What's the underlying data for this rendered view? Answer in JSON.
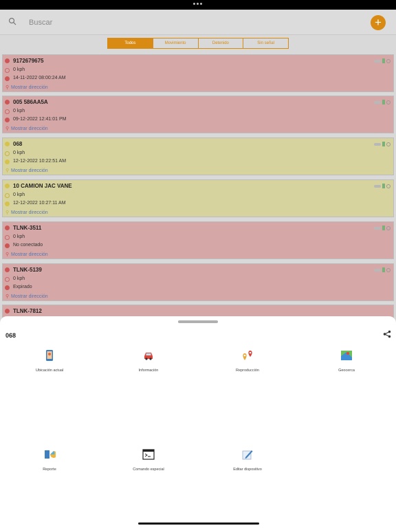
{
  "search": {
    "placeholder": "Buscar"
  },
  "add_label": "+",
  "tabs": [
    "Todos",
    "Movimiento",
    "Detenido",
    "Sin señal"
  ],
  "devices": [
    {
      "name": "9172679675",
      "speed": "0 kph",
      "time": "14-11-2022 08:00:24 AM",
      "address": "Mostrar dirección",
      "color": "red"
    },
    {
      "name": "005 586AA5A",
      "speed": "0 kph",
      "time": "09-12-2022 12:41:01 PM",
      "address": "Mostrar dirección",
      "color": "red"
    },
    {
      "name": "068",
      "speed": "0 kph",
      "time": "12-12-2022 10:22:51 AM",
      "address": "Mostrar dirección",
      "color": "yellow"
    },
    {
      "name": "10 CAMION JAC VANE",
      "speed": "0 kph",
      "time": "12-12-2022 10:27:11 AM",
      "address": "Mostrar dirección",
      "color": "yellow"
    },
    {
      "name": "TLNK-3511",
      "speed": "0 kph",
      "time": "No conectado",
      "address": "Mostrar dirección",
      "color": "red"
    },
    {
      "name": "TLNK-5139",
      "speed": "0 kph",
      "time": "Expirado",
      "address": "Mostrar dirección",
      "color": "red"
    },
    {
      "name": "TLNK-7812",
      "speed": "",
      "time": "",
      "address": "",
      "color": "red"
    }
  ],
  "sheet": {
    "title": "068",
    "actions": [
      "Ubicación actual",
      "Información",
      "Reproducción",
      "Geocerca",
      "Reporte",
      "Comando especial",
      "Editar dispositivo"
    ]
  }
}
